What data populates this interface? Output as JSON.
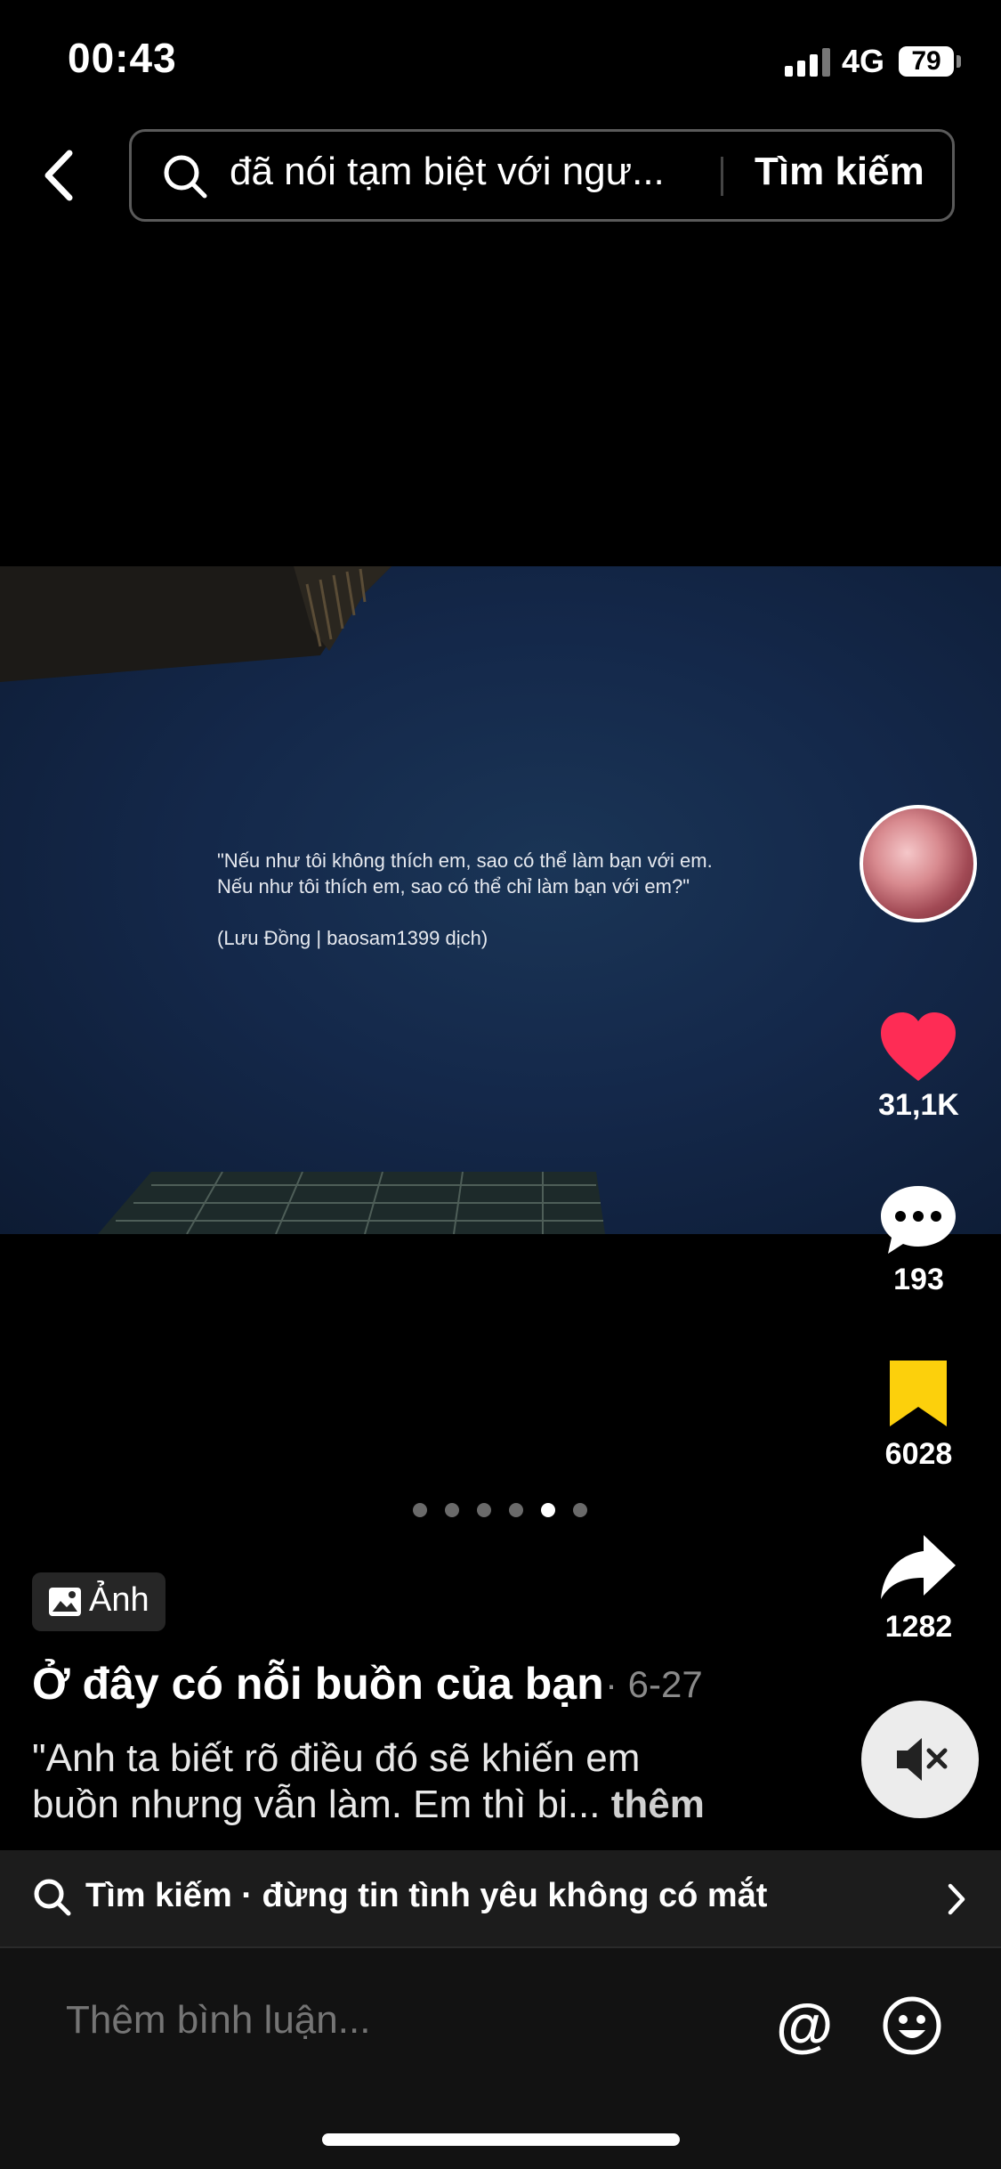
{
  "status_bar": {
    "time": "00:43",
    "network": "4G",
    "battery": "79"
  },
  "search": {
    "query": "đã nói tạm biệt với ngư...",
    "submit_label": "Tìm kiếm"
  },
  "post": {
    "quote_lines": [
      "\"Nếu như tôi không thích em, sao có thể làm bạn với em.",
      "Nếu như tôi thích em, sao có thể chỉ làm bạn với em?\"",
      "(Lưu Đồng | baosam1399 dịch)"
    ],
    "type_badge": "Ảnh",
    "title": "Ở đây có nỗi buồn của bạn",
    "date": "· 6-27",
    "description_lines": [
      "\"Anh ta biết rõ điều đó sẽ khiến em",
      "buồn nhưng vẫn làm. Em thì bi..."
    ],
    "more_label": "thêm",
    "carousel": {
      "total": 6,
      "active_index": 5
    }
  },
  "actions": {
    "likes": "31,1K",
    "comments": "193",
    "saves": "6028",
    "shares": "1282"
  },
  "colors": {
    "like": "#fe2c55",
    "save": "#fcd00c"
  },
  "suggested_search": "Tìm kiếm · đừng tin tình yêu không có mắt",
  "comment": {
    "placeholder": "Thêm bình luận..."
  },
  "icons": {
    "back": "chevron-left-icon",
    "search": "search-icon",
    "like": "heart-icon",
    "comment": "chat-bubble-icon",
    "save": "bookmark-icon",
    "share": "share-arrow-icon",
    "mute": "speaker-muted-icon",
    "mention": "at-icon",
    "emoji": "smiley-icon"
  }
}
